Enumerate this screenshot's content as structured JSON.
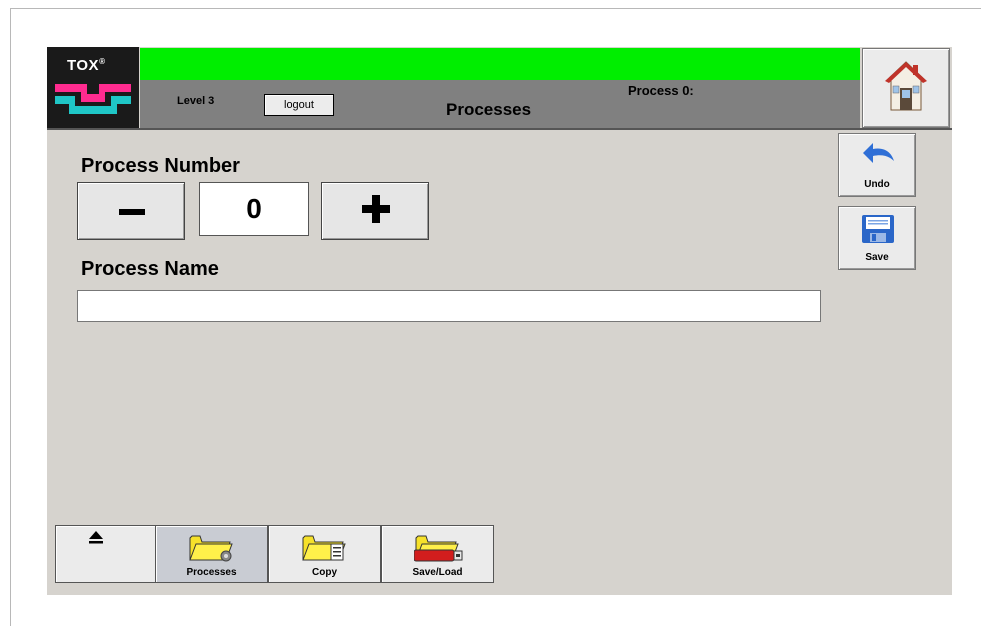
{
  "header": {
    "logo_text": "TOX",
    "logo_mark": "®",
    "level": "Level 3",
    "logout_label": "logout",
    "process_status": "Process 0:",
    "title": "Processes",
    "status_color": "#00ee00"
  },
  "side": {
    "undo_label": "Undo",
    "save_label": "Save"
  },
  "main": {
    "process_number_label": "Process Number",
    "process_number_value": "0",
    "process_name_label": "Process Name",
    "process_name_value": ""
  },
  "tabs": {
    "processes_label": "Processes",
    "copy_label": "Copy",
    "saveload_label": "Save/Load"
  },
  "icons": {
    "home": "home-icon",
    "undo": "undo-arrow-icon",
    "save": "floppy-disk-icon",
    "eject": "eject-icon",
    "processes": "folder-gear-icon",
    "copy": "folder-document-icon",
    "saveload": "folder-usb-icon"
  }
}
